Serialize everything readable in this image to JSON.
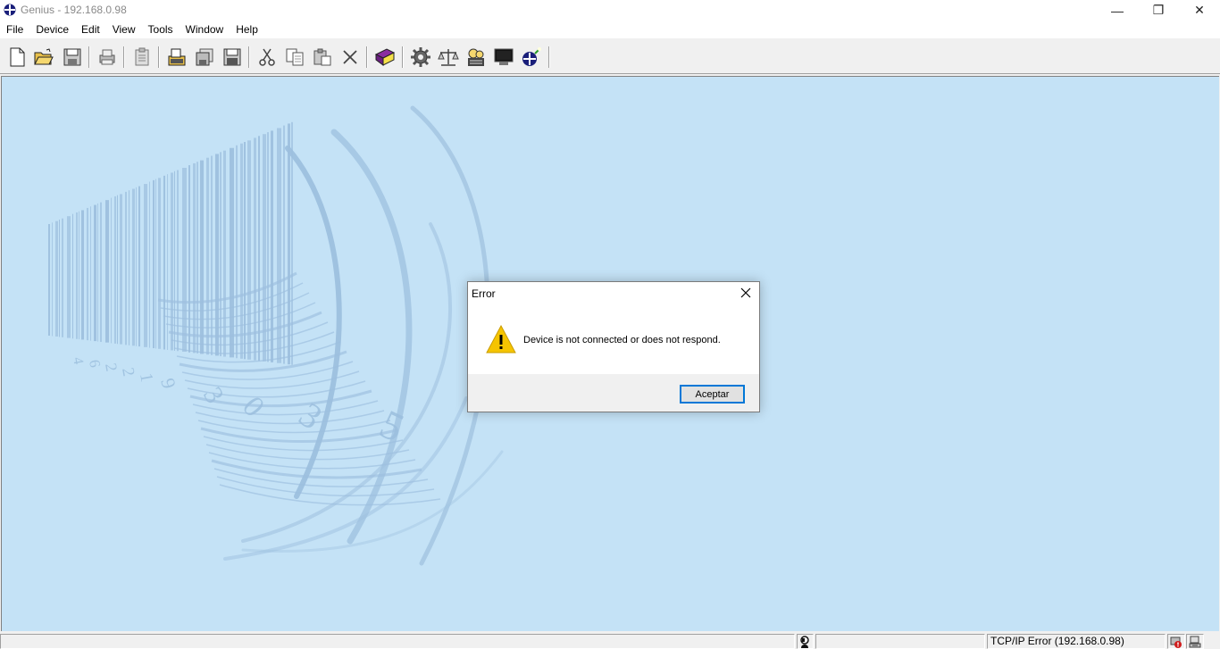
{
  "window": {
    "title": "Genius - 192.168.0.98",
    "minimize_glyph": "—",
    "restore_glyph": "❐",
    "close_glyph": "✕"
  },
  "menu": [
    "File",
    "Device",
    "Edit",
    "View",
    "Tools",
    "Window",
    "Help"
  ],
  "toolbar": {
    "buttons": [
      "new-document-icon",
      "open-folder-icon",
      "save-disk-icon",
      "print-icon",
      "clipboard-icon",
      "open-file-icon",
      "copy-disk-icon",
      "save-all-icon",
      "cut-icon",
      "copy-icon",
      "paste-icon",
      "delete-icon",
      "book-icon",
      "gear-icon",
      "scale-icon",
      "device-settings-icon",
      "monitor-icon",
      "connect-icon"
    ]
  },
  "background": {
    "barcode_digits": [
      "4",
      "6",
      "2",
      "2",
      "1",
      "9",
      "3",
      "0",
      "3",
      "5"
    ]
  },
  "dialog": {
    "title": "Error",
    "message": "Device is not connected or does not respond.",
    "ok_label": "Aceptar",
    "icon": "warning-icon"
  },
  "statusbar": {
    "main_text": "",
    "blank_text": "",
    "tcp_status": "TCP/IP Error (192.168.0.98)"
  },
  "colors": {
    "workspace": "#c4e2f6",
    "barcode": "#9cbfde",
    "warning": "#f5c400",
    "accent": "#0078d7"
  }
}
